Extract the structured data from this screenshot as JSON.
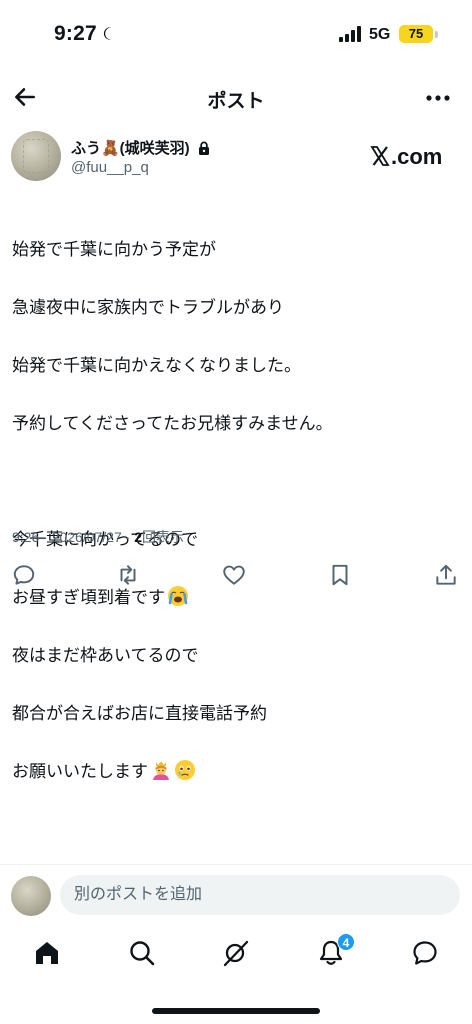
{
  "status_bar": {
    "time": "9:27",
    "network": "5G",
    "battery": "75",
    "battery_color": "#f7d51e"
  },
  "header": {
    "title": "ポスト"
  },
  "author": {
    "name": "ふう🧸(城咲芙羽)",
    "handle": "@fuu__p_q",
    "protected": true
  },
  "brand": {
    "logo_text": ".com"
  },
  "post": {
    "lines": [
      "始発で千葉に向かう予定が",
      "急遽夜中に家族内でトラブルがあり",
      "始発で千葉に向かえなくなりました。",
      "予約してくださってたお兄様すみません。",
      "",
      "今千葉に向かってるので",
      "お昼すぎ頃到着です",
      "夜はまだ枠あいてるので",
      "都合が合えばお店に直接電話予約",
      "お願いいたします"
    ],
    "emojis": {
      "line7": "loudly-crying-face",
      "line10": [
        "person-with-crown",
        "face-holding-back-tears"
      ]
    }
  },
  "meta": {
    "time_date": "9:26 · 2026/07/27 · ",
    "views_count": "2",
    "views_label": "回表示"
  },
  "actions": [
    "reply",
    "repost",
    "like",
    "bookmark",
    "share"
  ],
  "reply_bar": {
    "placeholder": "別のポストを追加"
  },
  "tabbar": {
    "notifications_badge": "4"
  },
  "colors": {
    "accent": "#1d9bf0",
    "text": "#0f1419",
    "secondary": "#536471"
  }
}
